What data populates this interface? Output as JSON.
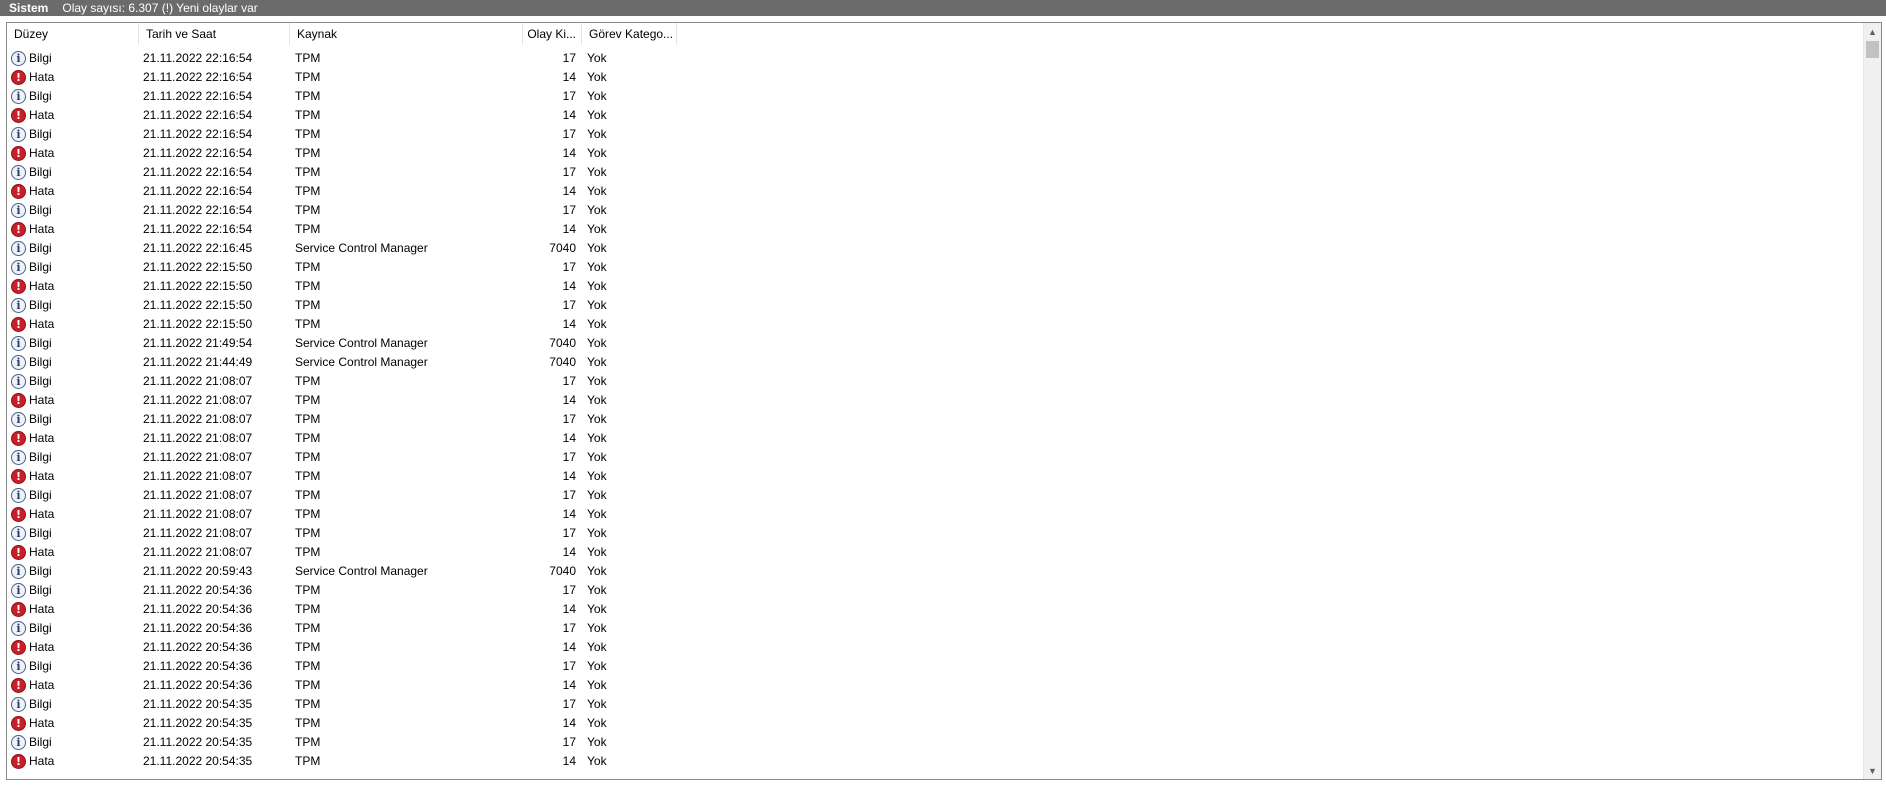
{
  "titlebar": {
    "log_name": "Sistem",
    "count_text": "Olay sayısı: 6.307 (!) Yeni olaylar var"
  },
  "columns": {
    "level": "Düzey",
    "date": "Tarih ve Saat",
    "source": "Kaynak",
    "event_id": "Olay Ki...",
    "task_category": "Görev Katego..."
  },
  "icons": {
    "info": "info-icon",
    "error": "error-icon"
  },
  "colors": {
    "titlebar_bg": "#6b6b6b",
    "error_icon": "#c8202a",
    "info_icon_border": "#4a5f80"
  },
  "rows": [
    {
      "level": "Bilgi",
      "type": "info",
      "date": "21.11.2022 22:16:54",
      "source": "TPM",
      "event_id": "17",
      "category": "Yok"
    },
    {
      "level": "Hata",
      "type": "error",
      "date": "21.11.2022 22:16:54",
      "source": "TPM",
      "event_id": "14",
      "category": "Yok"
    },
    {
      "level": "Bilgi",
      "type": "info",
      "date": "21.11.2022 22:16:54",
      "source": "TPM",
      "event_id": "17",
      "category": "Yok"
    },
    {
      "level": "Hata",
      "type": "error",
      "date": "21.11.2022 22:16:54",
      "source": "TPM",
      "event_id": "14",
      "category": "Yok"
    },
    {
      "level": "Bilgi",
      "type": "info",
      "date": "21.11.2022 22:16:54",
      "source": "TPM",
      "event_id": "17",
      "category": "Yok"
    },
    {
      "level": "Hata",
      "type": "error",
      "date": "21.11.2022 22:16:54",
      "source": "TPM",
      "event_id": "14",
      "category": "Yok"
    },
    {
      "level": "Bilgi",
      "type": "info",
      "date": "21.11.2022 22:16:54",
      "source": "TPM",
      "event_id": "17",
      "category": "Yok"
    },
    {
      "level": "Hata",
      "type": "error",
      "date": "21.11.2022 22:16:54",
      "source": "TPM",
      "event_id": "14",
      "category": "Yok"
    },
    {
      "level": "Bilgi",
      "type": "info",
      "date": "21.11.2022 22:16:54",
      "source": "TPM",
      "event_id": "17",
      "category": "Yok"
    },
    {
      "level": "Hata",
      "type": "error",
      "date": "21.11.2022 22:16:54",
      "source": "TPM",
      "event_id": "14",
      "category": "Yok"
    },
    {
      "level": "Bilgi",
      "type": "info",
      "date": "21.11.2022 22:16:45",
      "source": "Service Control Manager",
      "event_id": "7040",
      "category": "Yok"
    },
    {
      "level": "Bilgi",
      "type": "info",
      "date": "21.11.2022 22:15:50",
      "source": "TPM",
      "event_id": "17",
      "category": "Yok"
    },
    {
      "level": "Hata",
      "type": "error",
      "date": "21.11.2022 22:15:50",
      "source": "TPM",
      "event_id": "14",
      "category": "Yok"
    },
    {
      "level": "Bilgi",
      "type": "info",
      "date": "21.11.2022 22:15:50",
      "source": "TPM",
      "event_id": "17",
      "category": "Yok"
    },
    {
      "level": "Hata",
      "type": "error",
      "date": "21.11.2022 22:15:50",
      "source": "TPM",
      "event_id": "14",
      "category": "Yok"
    },
    {
      "level": "Bilgi",
      "type": "info",
      "date": "21.11.2022 21:49:54",
      "source": "Service Control Manager",
      "event_id": "7040",
      "category": "Yok"
    },
    {
      "level": "Bilgi",
      "type": "info",
      "date": "21.11.2022 21:44:49",
      "source": "Service Control Manager",
      "event_id": "7040",
      "category": "Yok"
    },
    {
      "level": "Bilgi",
      "type": "info",
      "date": "21.11.2022 21:08:07",
      "source": "TPM",
      "event_id": "17",
      "category": "Yok"
    },
    {
      "level": "Hata",
      "type": "error",
      "date": "21.11.2022 21:08:07",
      "source": "TPM",
      "event_id": "14",
      "category": "Yok"
    },
    {
      "level": "Bilgi",
      "type": "info",
      "date": "21.11.2022 21:08:07",
      "source": "TPM",
      "event_id": "17",
      "category": "Yok"
    },
    {
      "level": "Hata",
      "type": "error",
      "date": "21.11.2022 21:08:07",
      "source": "TPM",
      "event_id": "14",
      "category": "Yok"
    },
    {
      "level": "Bilgi",
      "type": "info",
      "date": "21.11.2022 21:08:07",
      "source": "TPM",
      "event_id": "17",
      "category": "Yok"
    },
    {
      "level": "Hata",
      "type": "error",
      "date": "21.11.2022 21:08:07",
      "source": "TPM",
      "event_id": "14",
      "category": "Yok"
    },
    {
      "level": "Bilgi",
      "type": "info",
      "date": "21.11.2022 21:08:07",
      "source": "TPM",
      "event_id": "17",
      "category": "Yok"
    },
    {
      "level": "Hata",
      "type": "error",
      "date": "21.11.2022 21:08:07",
      "source": "TPM",
      "event_id": "14",
      "category": "Yok"
    },
    {
      "level": "Bilgi",
      "type": "info",
      "date": "21.11.2022 21:08:07",
      "source": "TPM",
      "event_id": "17",
      "category": "Yok"
    },
    {
      "level": "Hata",
      "type": "error",
      "date": "21.11.2022 21:08:07",
      "source": "TPM",
      "event_id": "14",
      "category": "Yok"
    },
    {
      "level": "Bilgi",
      "type": "info",
      "date": "21.11.2022 20:59:43",
      "source": "Service Control Manager",
      "event_id": "7040",
      "category": "Yok"
    },
    {
      "level": "Bilgi",
      "type": "info",
      "date": "21.11.2022 20:54:36",
      "source": "TPM",
      "event_id": "17",
      "category": "Yok"
    },
    {
      "level": "Hata",
      "type": "error",
      "date": "21.11.2022 20:54:36",
      "source": "TPM",
      "event_id": "14",
      "category": "Yok"
    },
    {
      "level": "Bilgi",
      "type": "info",
      "date": "21.11.2022 20:54:36",
      "source": "TPM",
      "event_id": "17",
      "category": "Yok"
    },
    {
      "level": "Hata",
      "type": "error",
      "date": "21.11.2022 20:54:36",
      "source": "TPM",
      "event_id": "14",
      "category": "Yok"
    },
    {
      "level": "Bilgi",
      "type": "info",
      "date": "21.11.2022 20:54:36",
      "source": "TPM",
      "event_id": "17",
      "category": "Yok"
    },
    {
      "level": "Hata",
      "type": "error",
      "date": "21.11.2022 20:54:36",
      "source": "TPM",
      "event_id": "14",
      "category": "Yok"
    },
    {
      "level": "Bilgi",
      "type": "info",
      "date": "21.11.2022 20:54:35",
      "source": "TPM",
      "event_id": "17",
      "category": "Yok"
    },
    {
      "level": "Hata",
      "type": "error",
      "date": "21.11.2022 20:54:35",
      "source": "TPM",
      "event_id": "14",
      "category": "Yok"
    },
    {
      "level": "Bilgi",
      "type": "info",
      "date": "21.11.2022 20:54:35",
      "source": "TPM",
      "event_id": "17",
      "category": "Yok"
    },
    {
      "level": "Hata",
      "type": "error",
      "date": "21.11.2022 20:54:35",
      "source": "TPM",
      "event_id": "14",
      "category": "Yok"
    }
  ]
}
